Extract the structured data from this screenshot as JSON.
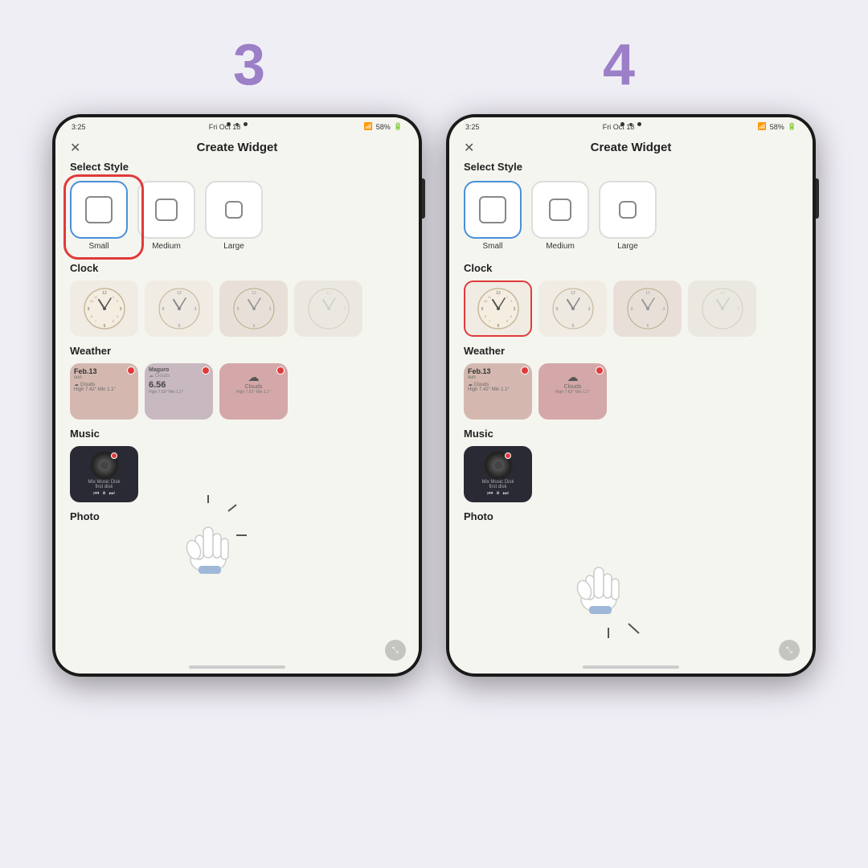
{
  "steps": [
    {
      "number": "3"
    },
    {
      "number": "4"
    }
  ],
  "shared": {
    "status_time": "3:25",
    "status_date": "Fri Oct 18",
    "status_signal": "58%",
    "header_title": "Create Widget",
    "close_label": "✕",
    "select_style_label": "Select Style",
    "styles": [
      {
        "id": "small",
        "label": "Small",
        "selected": true
      },
      {
        "id": "medium",
        "label": "Medium",
        "selected": false
      },
      {
        "id": "large",
        "label": "Large",
        "selected": false
      }
    ],
    "clock_section_label": "Clock",
    "weather_section_label": "Weather",
    "music_section_label": "Music",
    "photo_section_label": "Photo",
    "music_track": "Mix Music Disk",
    "music_artist": "first disk"
  },
  "step3": {
    "highlight": "style-small",
    "cursor_target": "clock-widget"
  },
  "step4": {
    "highlight": "clock-widget-1",
    "cursor_target": "weather-section"
  }
}
